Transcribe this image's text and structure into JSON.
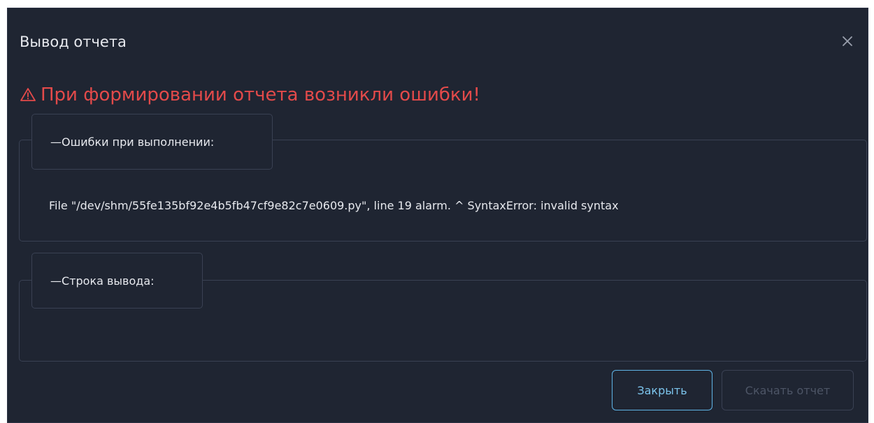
{
  "dialog": {
    "title": "Вывод отчета",
    "close_icon": "close-icon"
  },
  "error_heading": {
    "icon": "warning-triangle-icon",
    "text": "При формировании отчета возникли ошибки!"
  },
  "errors_section": {
    "legend": "—Ошибки при выполнении:",
    "message": "File \"/dev/shm/55fe135bf92e4b5fb47cf9e82c7e0609.py\", line 19 alarm. ^ SyntaxError: invalid syntax"
  },
  "output_section": {
    "legend": "—Строка вывода:",
    "content": ""
  },
  "buttons": {
    "close_label": "Закрыть",
    "download_label": "Скачать отчет"
  },
  "colors": {
    "background": "#1f2532",
    "error": "#e34a4a",
    "accent": "#5fb4e6",
    "disabled_text": "#4d5566"
  }
}
